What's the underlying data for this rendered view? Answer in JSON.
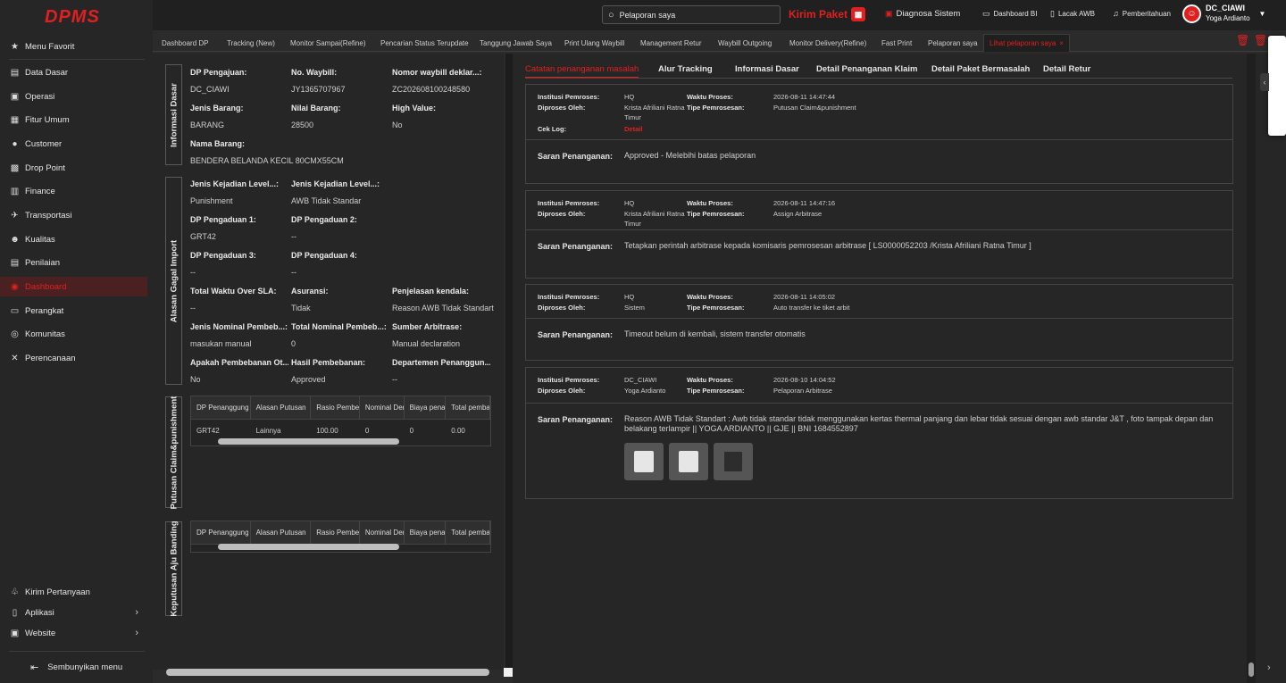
{
  "app": {
    "logo": "DPMS"
  },
  "sidebar": {
    "favorite": "Menu Favorit",
    "items": [
      {
        "label": "Data Dasar",
        "icon": "file-icon"
      },
      {
        "label": "Operasi",
        "icon": "monitor-icon"
      },
      {
        "label": "Fitur Umum",
        "icon": "briefcase-icon"
      },
      {
        "label": "Customer",
        "icon": "user-icon"
      },
      {
        "label": "Drop Point",
        "icon": "store-icon"
      },
      {
        "label": "Finance",
        "icon": "bank-icon"
      },
      {
        "label": "Transportasi",
        "icon": "plane-icon"
      },
      {
        "label": "Kualitas",
        "icon": "users-icon"
      },
      {
        "label": "Penilaian",
        "icon": "clipboard-icon"
      },
      {
        "label": "Dashboard",
        "icon": "dashboard-icon",
        "active": true
      },
      {
        "label": "Perangkat",
        "icon": "device-icon"
      },
      {
        "label": "Komunitas",
        "icon": "globe-icon"
      },
      {
        "label": "Perencanaan",
        "icon": "tools-icon"
      }
    ],
    "bottom": [
      {
        "label": "Kirim Pertanyaan",
        "icon": "question-icon"
      },
      {
        "label": "Aplikasi",
        "icon": "phone-icon"
      },
      {
        "label": "Website",
        "icon": "monitor-icon"
      }
    ],
    "hide_menu": "Sembunyikan menu"
  },
  "topbar": {
    "search_value": "Pelaporan saya",
    "kirim_paket": "Kirim Paket",
    "diagnosa": "Diagnosa Sistem",
    "dashboard_bi": "Dashboard BI",
    "lacak_awb": "Lacak AWB",
    "pemberitahuan": "Pemberitahuan",
    "user_code": "DC_CIAWI",
    "user_name": "Yoga Ardianto"
  },
  "tabs": [
    "Dashboard DP",
    "Tracking (New)",
    "Monitor Sampai(Refine)",
    "Pencarian Status Terupdate",
    "Tanggung Jawab Saya",
    "Print Ulang Waybill",
    "Management Retur",
    "Waybill Outgoing",
    "Monitor Delivery(Refine)",
    "Fast Print",
    "Pelaporan saya",
    "Lihat pelaporan saya"
  ],
  "left": {
    "sections": [
      "Informasi Dasar",
      "Alasan Gagal Import",
      "Putusan Claim&punishment",
      "Keputusan Aju Banding"
    ],
    "fields": [
      {
        "label": "DP Pengajuan:",
        "value": "DC_CIAWI"
      },
      {
        "label": "No. Waybill:",
        "value": "JY1365707967"
      },
      {
        "label": "Nomor waybill deklar...:",
        "value": "ZC202608100248580"
      },
      {
        "label": "Jenis Barang:",
        "value": "BARANG"
      },
      {
        "label": "Nilai Barang:",
        "value": "28500"
      },
      {
        "label": "High Value:",
        "value": "No"
      },
      {
        "label": "Nama Barang:",
        "value": "BENDERA BELANDA KECIL 80CMX55CM"
      },
      {
        "label": "Jenis Kejadian Level...:",
        "value": "Punishment"
      },
      {
        "label": "Jenis Kejadian Level...:",
        "value": "AWB Tidak Standar"
      },
      {
        "label": "DP Pengaduan 1:",
        "value": "GRT42"
      },
      {
        "label": "DP Pengaduan 2:",
        "value": "--"
      },
      {
        "label": "DP Pengaduan 3:",
        "value": "--"
      },
      {
        "label": "DP Pengaduan 4:",
        "value": "--"
      },
      {
        "label": "Total Waktu Over SLA:",
        "value": "--"
      },
      {
        "label": "Asuransi:",
        "value": "Tidak"
      },
      {
        "label": "Penjelasan kendala:",
        "value": "Reason AWB Tidak Standart"
      },
      {
        "label": "Jenis Nominal Pembeb...:",
        "value": "masukan manual"
      },
      {
        "label": "Total Nominal Pembeb...:",
        "value": "0"
      },
      {
        "label": "Sumber Arbitrase:",
        "value": "Manual declaration"
      },
      {
        "label": "Apakah Pembebanan Ot...:",
        "value": "No"
      },
      {
        "label": "Hasil Pembebanan:",
        "value": "Approved"
      },
      {
        "label": "Departemen Penanggun...:",
        "value": "--"
      }
    ],
    "table_headers": [
      "DP Penanggung ...",
      "Alasan Putusan",
      "Rasio Pembeb...",
      "Nominal Den...",
      "Biaya penan...",
      "Total pemba..."
    ],
    "table_row": [
      "GRT42",
      "Lainnya",
      "100.00",
      "0",
      "0",
      "0.00"
    ]
  },
  "right": {
    "tabs": [
      "Catatan penanganan masalah",
      "Alur Tracking",
      "Informasi Dasar",
      "Detail Penanganan Klaim",
      "Detail Paket Bermasalah",
      "Detail Retur"
    ],
    "labels": {
      "institusi": "Institusi Pemroses:",
      "diproses": "Diproses Oleh:",
      "waktu": "Waktu Proses:",
      "tipe": "Tipe Pemrosesan:",
      "ceklog": "Cek Log:",
      "detail": "Detail",
      "saran": "Saran Penanganan:"
    },
    "cards": [
      {
        "institusi": "HQ",
        "diproses": "Krista Afriliani Ratna Timur",
        "waktu": "2026-08-11 14:47:44",
        "tipe": "Putusan Claim&punishment",
        "saran": "Approved - Melebihi batas pelaporan"
      },
      {
        "institusi": "HQ",
        "diproses": "Krista Afriliani Ratna Timur",
        "waktu": "2026-08-11 14:47:16",
        "tipe": "Assign Arbitrase",
        "saran": "Tetapkan perintah arbitrase kepada komisaris pemrosesan arbitrase [ LS0000052203 /Krista Afriliani Ratna Timur ]"
      },
      {
        "institusi": "HQ",
        "diproses": "Sistem",
        "waktu": "2026-08-11 14:05:02",
        "tipe": "Auto transfer ke tiket arbit",
        "saran": "Timeout belum di kembali, sistem transfer otomatis"
      },
      {
        "institusi": "DC_CIAWI",
        "diproses": "Yoga Ardianto",
        "waktu": "2026-08-10 14:04:52",
        "tipe": "Pelaporan Arbitrase",
        "saran": "Reason AWB Tidak Standart : Awb tidak standar tidak menggunakan kertas thermal panjang dan lebar tidak sesuai dengan awb standar J&T , foto tampak depan dan belakang terlampir || YOGA ARDIANTO || GJE || BNI 1684552897"
      }
    ]
  }
}
